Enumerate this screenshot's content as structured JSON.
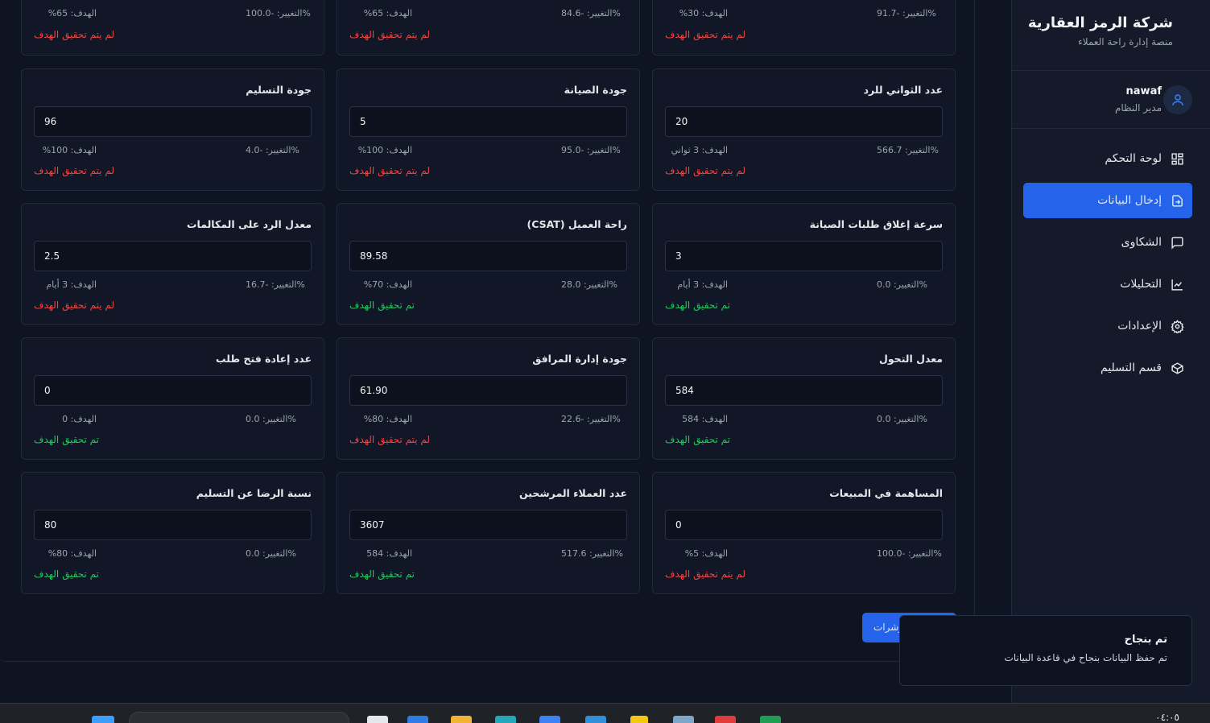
{
  "sidebar": {
    "company": "شركة الرمز العقارية",
    "tagline": "منصة إدارة راحة العملاء",
    "user": {
      "name": "nawaf",
      "role": "مدير النظام"
    },
    "nav": [
      {
        "label": "لوحة التحكم",
        "icon": "dashboard-grid-icon",
        "active": false
      },
      {
        "label": "إدخال البيانات",
        "icon": "data-entry-icon",
        "active": true
      },
      {
        "label": "الشكاوى",
        "icon": "chat-bubble-icon",
        "active": false
      },
      {
        "label": "التحليلات",
        "icon": "line-chart-icon",
        "active": false
      },
      {
        "label": "الإعدادات",
        "icon": "gear-icon",
        "active": false
      },
      {
        "label": "قسم التسليم",
        "icon": "package-box-icon",
        "active": false
      }
    ]
  },
  "rows": [
    [
      {
        "label": "",
        "value": "",
        "change": "التغيير: -91.7%",
        "target": "الهدف: 30%",
        "status": "لم يتم تحقيق الهدف",
        "ok": false
      },
      {
        "label": "",
        "value": "",
        "change": "التغيير: -84.6%",
        "target": "الهدف: 65%",
        "status": "لم يتم تحقيق الهدف",
        "ok": false
      },
      {
        "label": "",
        "value": "",
        "change": "التغيير: -100.0%",
        "target": "الهدف: 65%",
        "status": "لم يتم تحقيق الهدف",
        "ok": false
      }
    ],
    [
      {
        "label": "عدد الثواني للرد",
        "value": "20",
        "change": "التغيير: 566.7%",
        "target": "الهدف: 3 ثواني",
        "status": "لم يتم تحقيق الهدف",
        "ok": false
      },
      {
        "label": "جودة الصيانة",
        "value": "5",
        "change": "التغيير: -95.0%",
        "target": "الهدف: 100%",
        "status": "لم يتم تحقيق الهدف",
        "ok": false
      },
      {
        "label": "جودة التسليم",
        "value": "96",
        "change": "التغيير: -4.0%",
        "target": "الهدف: 100%",
        "status": "لم يتم تحقيق الهدف",
        "ok": false
      }
    ],
    [
      {
        "label": "سرعة إغلاق طلبات الصيانة",
        "value": "3",
        "change": "التغيير: 0.0%",
        "target": "الهدف: 3 أيام",
        "status": "تم تحقيق الهدف",
        "ok": true
      },
      {
        "label": "راحة العميل (CSAT)",
        "value": "89.58",
        "change": "التغيير: 28.0%",
        "target": "الهدف: 70%",
        "status": "تم تحقيق الهدف",
        "ok": true
      },
      {
        "label": "معدل الرد على المكالمات",
        "value": "2.5",
        "change": "التغيير: -16.7%",
        "target": "الهدف: 3 أيام",
        "status": "لم يتم تحقيق الهدف",
        "ok": false
      }
    ],
    [
      {
        "label": "معدل التحول",
        "value": "584",
        "change": "التغيير: 0.0%",
        "target": "الهدف: 584",
        "status": "تم تحقيق الهدف",
        "ok": true
      },
      {
        "label": "جودة إدارة المرافق",
        "value": "61.90",
        "change": "التغيير: -22.6%",
        "target": "الهدف: 80%",
        "status": "لم يتم تحقيق الهدف",
        "ok": false
      },
      {
        "label": "عدد إعادة فتح طلب",
        "value": "0",
        "change": "التغيير: 0.0%",
        "target": "الهدف: 0",
        "status": "تم تحقيق الهدف",
        "ok": true
      }
    ],
    [
      {
        "label": "المساهمة في المبيعات",
        "value": "0",
        "change": "التغيير: -100.0%",
        "target": "الهدف: 5%",
        "status": "لم يتم تحقيق الهدف",
        "ok": false
      },
      {
        "label": "عدد العملاء المرشحين",
        "value": "3607",
        "change": "التغيير: 517.6%",
        "target": "الهدف: 584",
        "status": "تم تحقيق الهدف",
        "ok": true
      },
      {
        "label": "نسبة الرضا عن التسليم",
        "value": "80",
        "change": "التغيير: 0.0%",
        "target": "الهدف: 80%",
        "status": "تم تحقيق الهدف",
        "ok": true
      }
    ]
  ],
  "save_button": "حفظ المؤشرات",
  "toast": {
    "title": "تم بنجاح",
    "message": "تم حفظ البيانات بنجاح في قاعدة البيانات"
  },
  "taskbar": {
    "clock": "٠٤:٠٥"
  },
  "colors": {
    "accent": "#2563eb",
    "success": "#22c55e",
    "error": "#ef4444",
    "background": "#0f1422"
  }
}
